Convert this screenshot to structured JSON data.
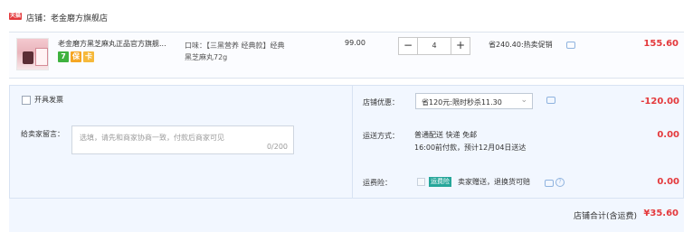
{
  "shop": {
    "badge": "天猫",
    "name": "店铺：老金磨方旗舰店"
  },
  "item": {
    "title": "老金磨方黑芝麻丸正品官方旗舰...",
    "attribute_line1": "口味：【三黑营养 经典款】经典",
    "attribute_line2": "黑芝麻丸72g",
    "unit_price": "99.00",
    "quantity": "4",
    "minus_label": "−",
    "plus_label": "+",
    "promo": "省240.40:热卖促销",
    "subtotal": "155.60",
    "tags": [
      "7",
      "保",
      "卡"
    ]
  },
  "invoice": {
    "label": "开具发票"
  },
  "memo": {
    "label": "给卖家留言：",
    "placeholder": "选填，请先和商家协商一致，付款后商家可见",
    "count": "0/200"
  },
  "coupon": {
    "label": "店铺优惠：",
    "selected": "省120元:限时秒杀11.30",
    "amount": "-120.00"
  },
  "shipping": {
    "label": "运送方式：",
    "line1": "普通配送 快递 免邮",
    "line2": "16:00前付款，预计12月04日送达",
    "amount": "0.00"
  },
  "insurance": {
    "label": "运费险：",
    "badge": "运费险",
    "text": "卖家赠送，退换货可赔",
    "amount": "0.00"
  },
  "total": {
    "label": "店铺合计(含运费)",
    "value": "¥35.60"
  }
}
